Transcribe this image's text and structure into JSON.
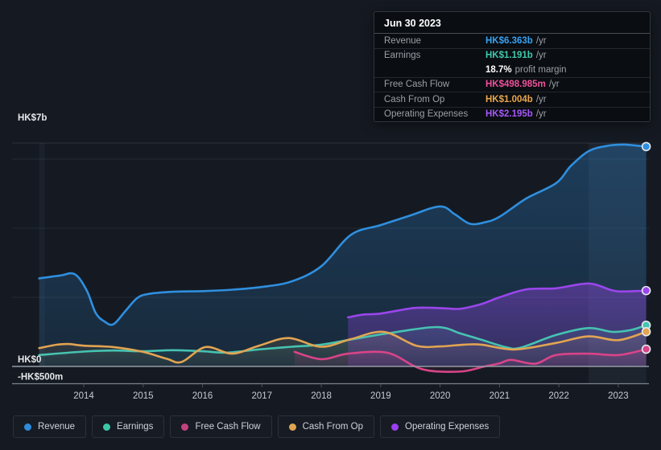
{
  "tooltip": {
    "date": "Jun 30 2023",
    "rows": [
      {
        "label": "Revenue",
        "value": "HK$6.363b",
        "suffix": "/yr",
        "color": "#36a2f4",
        "divider": true
      },
      {
        "label": "Earnings",
        "value": "HK$1.191b",
        "suffix": "/yr",
        "color": "#3fc9ad",
        "divider": false
      },
      {
        "label": "",
        "value": "18.7%",
        "suffix": "profit margin",
        "color": "#ffffff",
        "divider": true
      },
      {
        "label": "Free Cash Flow",
        "value": "HK$498.985m",
        "suffix": "/yr",
        "color": "#ef509c",
        "divider": true
      },
      {
        "label": "Cash From Op",
        "value": "HK$1.004b",
        "suffix": "/yr",
        "color": "#eaa64d",
        "divider": true
      },
      {
        "label": "Operating Expenses",
        "value": "HK$2.195b",
        "suffix": "/yr",
        "color": "#a558fa",
        "divider": false
      }
    ]
  },
  "legend": [
    {
      "label": "Revenue",
      "color": "#2e8bdb"
    },
    {
      "label": "Earnings",
      "color": "#3cc8a8"
    },
    {
      "label": "Free Cash Flow",
      "color": "#c4417f"
    },
    {
      "label": "Cash From Op",
      "color": "#e0a44e"
    },
    {
      "label": "Operating Expenses",
      "color": "#9a3ff0"
    }
  ],
  "chart_data": {
    "type": "area",
    "title": "Financial history: revenue, earnings, cash flow and expenses (HK$)",
    "x_axis": {
      "tick_years": [
        2014,
        2015,
        2016,
        2017,
        2018,
        2019,
        2020,
        2021,
        2022,
        2023
      ],
      "range": [
        2013.25,
        2023.5
      ]
    },
    "y_axis": {
      "labels": [
        {
          "text": "HK$7b",
          "value": 7
        },
        {
          "text": "HK$0",
          "value": 0
        },
        {
          "text": "-HK$500m",
          "value": -0.5
        }
      ],
      "gridline_values": [
        6,
        4,
        2
      ],
      "ylim": [
        -0.5,
        7
      ]
    },
    "highlight_band": {
      "from_year": 2022.5,
      "to_year": 2023.47
    },
    "series": [
      {
        "name": "Revenue",
        "color": "#2f8fdf",
        "fill_opacity": [
          0.3,
          0.13
        ],
        "points": [
          [
            2013.25,
            2.55
          ],
          [
            2013.6,
            2.63
          ],
          [
            2013.85,
            2.67
          ],
          [
            2014.05,
            2.2
          ],
          [
            2014.2,
            1.55
          ],
          [
            2014.35,
            1.3
          ],
          [
            2014.5,
            1.22
          ],
          [
            2014.7,
            1.6
          ],
          [
            2014.9,
            1.98
          ],
          [
            2015.1,
            2.1
          ],
          [
            2015.5,
            2.16
          ],
          [
            2016.0,
            2.18
          ],
          [
            2016.5,
            2.22
          ],
          [
            2017.0,
            2.3
          ],
          [
            2017.5,
            2.46
          ],
          [
            2018.0,
            2.9
          ],
          [
            2018.5,
            3.81
          ],
          [
            2019.0,
            4.09
          ],
          [
            2019.5,
            4.37
          ],
          [
            2020.0,
            4.63
          ],
          [
            2020.25,
            4.4
          ],
          [
            2020.5,
            4.13
          ],
          [
            2020.75,
            4.17
          ],
          [
            2021.0,
            4.33
          ],
          [
            2021.45,
            4.86
          ],
          [
            2021.95,
            5.3
          ],
          [
            2022.2,
            5.8
          ],
          [
            2022.5,
            6.23
          ],
          [
            2022.8,
            6.38
          ],
          [
            2023.1,
            6.42
          ],
          [
            2023.47,
            6.363
          ]
        ]
      },
      {
        "name": "Earnings",
        "color": "#46c3b1",
        "fill_opacity": [
          0.16,
          0.04
        ],
        "points": [
          [
            2013.25,
            0.33
          ],
          [
            2014.0,
            0.43
          ],
          [
            2014.5,
            0.46
          ],
          [
            2015.0,
            0.44
          ],
          [
            2015.5,
            0.47
          ],
          [
            2016.0,
            0.44
          ],
          [
            2016.4,
            0.4
          ],
          [
            2017.0,
            0.5
          ],
          [
            2017.5,
            0.57
          ],
          [
            2018.0,
            0.63
          ],
          [
            2018.5,
            0.78
          ],
          [
            2019.2,
            0.98
          ],
          [
            2019.95,
            1.14
          ],
          [
            2020.35,
            0.95
          ],
          [
            2020.7,
            0.77
          ],
          [
            2021.1,
            0.56
          ],
          [
            2021.35,
            0.54
          ],
          [
            2021.95,
            0.91
          ],
          [
            2022.5,
            1.11
          ],
          [
            2022.9,
            1.0
          ],
          [
            2023.2,
            1.05
          ],
          [
            2023.47,
            1.191
          ]
        ]
      },
      {
        "name": "Cash From Op",
        "color": "#e2a452",
        "fill_opacity": [
          0.15,
          0.04
        ],
        "points": [
          [
            2013.25,
            0.53
          ],
          [
            2013.55,
            0.63
          ],
          [
            2013.75,
            0.65
          ],
          [
            2014.0,
            0.6
          ],
          [
            2014.5,
            0.56
          ],
          [
            2015.0,
            0.42
          ],
          [
            2015.4,
            0.22
          ],
          [
            2015.65,
            0.13
          ],
          [
            2016.05,
            0.56
          ],
          [
            2016.5,
            0.37
          ],
          [
            2016.95,
            0.6
          ],
          [
            2017.45,
            0.82
          ],
          [
            2018.0,
            0.57
          ],
          [
            2018.5,
            0.79
          ],
          [
            2019.05,
            1.0
          ],
          [
            2019.6,
            0.6
          ],
          [
            2020.0,
            0.58
          ],
          [
            2020.4,
            0.63
          ],
          [
            2020.7,
            0.63
          ],
          [
            2021.25,
            0.49
          ],
          [
            2021.95,
            0.68
          ],
          [
            2022.5,
            0.87
          ],
          [
            2023.0,
            0.76
          ],
          [
            2023.47,
            1.004
          ]
        ]
      },
      {
        "name": "Operating Expenses",
        "color": "#9a46ec",
        "fill_opacity": [
          0.4,
          0.18
        ],
        "points": [
          [
            2018.45,
            1.42
          ],
          [
            2018.7,
            1.5
          ],
          [
            2019.0,
            1.53
          ],
          [
            2019.5,
            1.68
          ],
          [
            2019.8,
            1.7
          ],
          [
            2020.1,
            1.68
          ],
          [
            2020.35,
            1.67
          ],
          [
            2020.7,
            1.81
          ],
          [
            2021.0,
            2.0
          ],
          [
            2021.45,
            2.23
          ],
          [
            2021.95,
            2.26
          ],
          [
            2022.5,
            2.4
          ],
          [
            2022.9,
            2.2
          ],
          [
            2023.1,
            2.17
          ],
          [
            2023.47,
            2.195
          ]
        ]
      },
      {
        "name": "Free Cash Flow",
        "color": "#d84488",
        "fill_opacity": [
          0.2,
          0.05
        ],
        "points": [
          [
            2017.55,
            0.42
          ],
          [
            2018.0,
            0.21
          ],
          [
            2018.45,
            0.37
          ],
          [
            2019.1,
            0.4
          ],
          [
            2019.55,
            0.02
          ],
          [
            2019.75,
            -0.1
          ],
          [
            2020.0,
            -0.15
          ],
          [
            2020.4,
            -0.14
          ],
          [
            2020.75,
            0.0
          ],
          [
            2021.0,
            0.09
          ],
          [
            2021.2,
            0.19
          ],
          [
            2021.6,
            0.08
          ],
          [
            2021.95,
            0.33
          ],
          [
            2022.5,
            0.37
          ],
          [
            2023.0,
            0.33
          ],
          [
            2023.47,
            0.499
          ]
        ]
      }
    ]
  }
}
